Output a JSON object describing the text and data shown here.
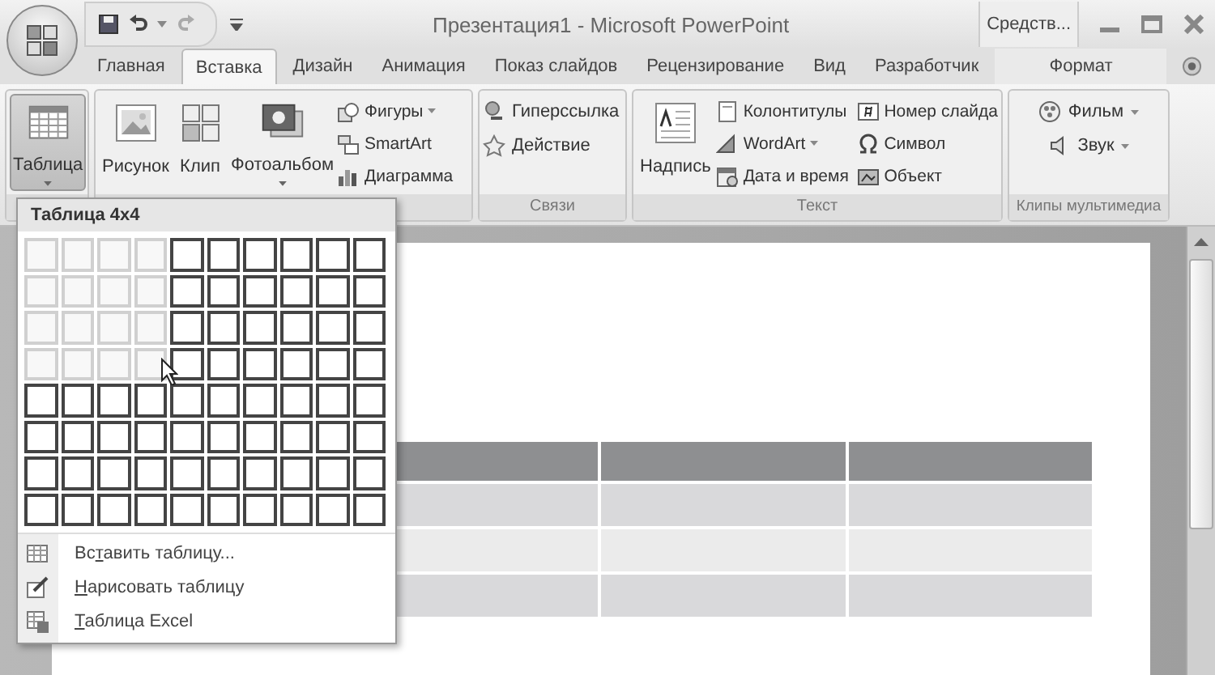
{
  "window": {
    "title": "Презентация1 - Microsoft PowerPoint",
    "context_label": "Средств..."
  },
  "tabs": [
    {
      "label": "Главная",
      "selected": false,
      "kind": "normal"
    },
    {
      "label": "Вставка",
      "selected": true,
      "kind": "normal"
    },
    {
      "label": "Дизайн",
      "selected": false,
      "kind": "normal"
    },
    {
      "label": "Анимация",
      "selected": false,
      "kind": "normal"
    },
    {
      "label": "Показ слайдов",
      "selected": false,
      "kind": "normal"
    },
    {
      "label": "Рецензирование",
      "selected": false,
      "kind": "normal"
    },
    {
      "label": "Вид",
      "selected": false,
      "kind": "normal"
    },
    {
      "label": "Разработчик",
      "selected": false,
      "kind": "normal"
    },
    {
      "label": "Формат",
      "selected": false,
      "kind": "context"
    }
  ],
  "ribbon": {
    "groups": [
      {
        "items": [
          {
            "kind": "large",
            "label": "Таблица",
            "dropdown": true,
            "pressed": true
          }
        ]
      },
      {
        "items": [
          {
            "kind": "large",
            "label": "Рисунок",
            "dropdown": false,
            "pressed": false
          },
          {
            "kind": "large",
            "label": "Клип",
            "dropdown": false,
            "pressed": false
          },
          {
            "kind": "large",
            "label": "Фотоальбом",
            "dropdown": true,
            "pressed": false
          },
          {
            "kind": "stack",
            "items": [
              {
                "label": "Фигуры",
                "dropdown": true
              },
              {
                "label": "SmartArt",
                "dropdown": false
              },
              {
                "label": "Диаграмма",
                "dropdown": false
              }
            ]
          }
        ]
      },
      {
        "label": "Связи",
        "items": [
          {
            "kind": "stack",
            "items": [
              {
                "label": "Гиперссылка",
                "dropdown": false
              },
              {
                "label": "Действие",
                "dropdown": false
              }
            ]
          }
        ]
      },
      {
        "label": "Текст",
        "items": [
          {
            "kind": "large",
            "label": "Надпись",
            "dropdown": false,
            "pressed": false
          },
          {
            "kind": "stack",
            "items": [
              {
                "label": "Колонтитулы",
                "dropdown": false
              },
              {
                "label": "WordArt",
                "dropdown": true
              },
              {
                "label": "Дата и время",
                "dropdown": false
              }
            ]
          },
          {
            "kind": "stack",
            "items": [
              {
                "label": "Номер слайда",
                "dropdown": false
              },
              {
                "label": "Символ",
                "dropdown": false
              },
              {
                "label": "Объект",
                "dropdown": false
              }
            ]
          }
        ]
      },
      {
        "label": "Клипы мультимедиа",
        "items": [
          {
            "kind": "stack",
            "items": [
              {
                "label": "Фильм",
                "dropdown": true
              },
              {
                "label": "Звук",
                "dropdown": true
              }
            ]
          }
        ]
      }
    ]
  },
  "table_menu": {
    "title": "Таблица 4x4",
    "grid": [
      {
        "cells": [
          {
            "selected": true
          },
          {
            "selected": true
          },
          {
            "selected": true
          },
          {
            "selected": true
          },
          {
            "selected": false
          },
          {
            "selected": false
          },
          {
            "selected": false
          },
          {
            "selected": false
          },
          {
            "selected": false
          },
          {
            "selected": false
          }
        ]
      },
      {
        "cells": [
          {
            "selected": true
          },
          {
            "selected": true
          },
          {
            "selected": true
          },
          {
            "selected": true
          },
          {
            "selected": false
          },
          {
            "selected": false
          },
          {
            "selected": false
          },
          {
            "selected": false
          },
          {
            "selected": false
          },
          {
            "selected": false
          }
        ]
      },
      {
        "cells": [
          {
            "selected": true
          },
          {
            "selected": true
          },
          {
            "selected": true
          },
          {
            "selected": true
          },
          {
            "selected": false
          },
          {
            "selected": false
          },
          {
            "selected": false
          },
          {
            "selected": false
          },
          {
            "selected": false
          },
          {
            "selected": false
          }
        ]
      },
      {
        "cells": [
          {
            "selected": true
          },
          {
            "selected": true
          },
          {
            "selected": true
          },
          {
            "selected": true
          },
          {
            "selected": false
          },
          {
            "selected": false
          },
          {
            "selected": false
          },
          {
            "selected": false
          },
          {
            "selected": false
          },
          {
            "selected": false
          }
        ]
      },
      {
        "cells": [
          {
            "selected": false
          },
          {
            "selected": false
          },
          {
            "selected": false
          },
          {
            "selected": false
          },
          {
            "selected": false
          },
          {
            "selected": false
          },
          {
            "selected": false
          },
          {
            "selected": false
          },
          {
            "selected": false
          },
          {
            "selected": false
          }
        ]
      },
      {
        "cells": [
          {
            "selected": false
          },
          {
            "selected": false
          },
          {
            "selected": false
          },
          {
            "selected": false
          },
          {
            "selected": false
          },
          {
            "selected": false
          },
          {
            "selected": false
          },
          {
            "selected": false
          },
          {
            "selected": false
          },
          {
            "selected": false
          }
        ]
      },
      {
        "cells": [
          {
            "selected": false
          },
          {
            "selected": false
          },
          {
            "selected": false
          },
          {
            "selected": false
          },
          {
            "selected": false
          },
          {
            "selected": false
          },
          {
            "selected": false
          },
          {
            "selected": false
          },
          {
            "selected": false
          },
          {
            "selected": false
          }
        ]
      },
      {
        "cells": [
          {
            "selected": false
          },
          {
            "selected": false
          },
          {
            "selected": false
          },
          {
            "selected": false
          },
          {
            "selected": false
          },
          {
            "selected": false
          },
          {
            "selected": false
          },
          {
            "selected": false
          },
          {
            "selected": false
          },
          {
            "selected": false
          }
        ]
      }
    ],
    "items": [
      {
        "before": "Вс",
        "key": "т",
        "after": "авить таблицу..."
      },
      {
        "key": "Н",
        "after": "арисовать таблицу"
      },
      {
        "key": "Т",
        "after": "аблица Excel"
      }
    ]
  },
  "slide": {
    "table_rows": [
      {
        "kind": "header"
      },
      {
        "kind": "band"
      },
      {
        "kind": "plain"
      },
      {
        "kind": "band"
      }
    ]
  }
}
